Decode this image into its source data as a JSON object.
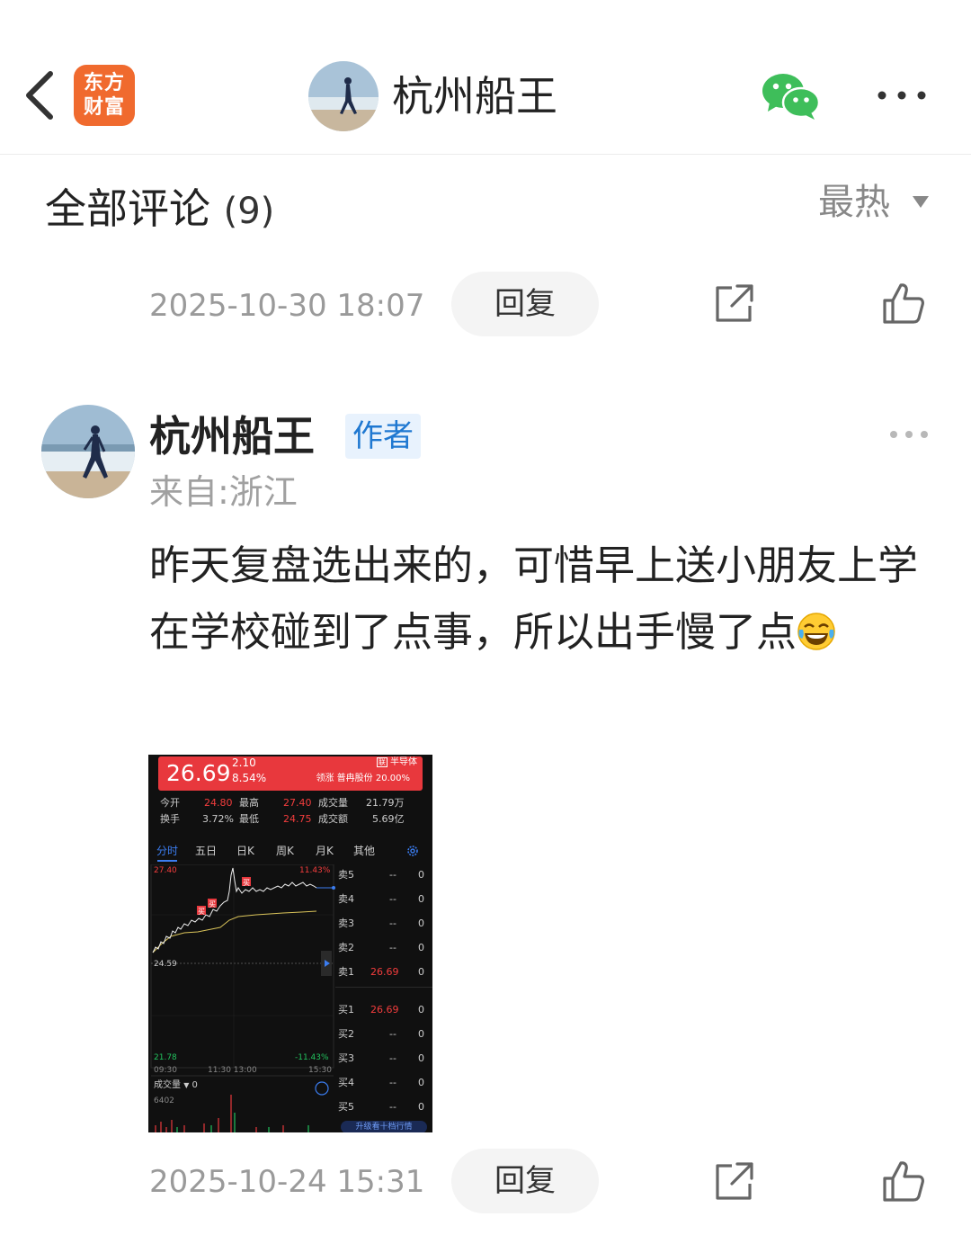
{
  "nav": {
    "logo_line1": "东方",
    "logo_line2": "财富",
    "title": "杭州船王",
    "icons": [
      "back-arrow-icon",
      "wechat-icon",
      "more-icon"
    ]
  },
  "section": {
    "title": "全部评论",
    "count": "(9)",
    "sort_label": "最热"
  },
  "top_row": {
    "time": "2025-10-30 18:07",
    "reply": "回复"
  },
  "comment": {
    "author": "杭州船王",
    "badge": "作者",
    "location": "来自:浙江",
    "text": "昨天复盘选出来的，可惜早上送小朋友上学在学校碰到了点事，所以出手慢了点",
    "time": "2025-10-24 15:31",
    "reply": "回复"
  },
  "stock_shot": {
    "price": "26.69",
    "change": "2.10",
    "change_pct": "8.54%",
    "sector": "半导体",
    "sector_prefix": "联",
    "lead": "领涨 普冉股份 20.00%",
    "quote": {
      "open_label": "今开",
      "open": "24.80",
      "high_label": "最高",
      "high": "27.40",
      "vol_label": "成交量",
      "vol": "21.79万",
      "turn_label": "换手",
      "turn": "3.72%",
      "low_label": "最低",
      "low": "24.75",
      "amt_label": "成交额",
      "amt": "5.69亿"
    },
    "tabs": [
      "分时",
      "五日",
      "日K",
      "周K",
      "月K",
      "其他"
    ],
    "chart_labels": {
      "top_price": "27.40",
      "top_pct": "11.43%",
      "mid_price": "24.59",
      "bottom_price": "21.78",
      "bottom_pct": "-11.43%",
      "t0": "09:30",
      "t1": "11:30 13:00",
      "t2": "15:30",
      "vol_label": "成交量",
      "vol_val": "0",
      "vol_max": "6402",
      "buy_mark": "买"
    },
    "sell": [
      {
        "label": "卖5",
        "price": "--",
        "qty": "0"
      },
      {
        "label": "卖4",
        "price": "--",
        "qty": "0"
      },
      {
        "label": "卖3",
        "price": "--",
        "qty": "0"
      },
      {
        "label": "卖2",
        "price": "--",
        "qty": "0"
      },
      {
        "label": "卖1",
        "price": "26.69",
        "qty": "0"
      }
    ],
    "buy": [
      {
        "label": "买1",
        "price": "26.69",
        "qty": "0"
      },
      {
        "label": "买2",
        "price": "--",
        "qty": "0"
      },
      {
        "label": "买3",
        "price": "--",
        "qty": "0"
      },
      {
        "label": "买4",
        "price": "--",
        "qty": "0"
      },
      {
        "label": "买5",
        "price": "--",
        "qty": "0"
      }
    ],
    "upgrade": "升级看十档行情"
  }
}
